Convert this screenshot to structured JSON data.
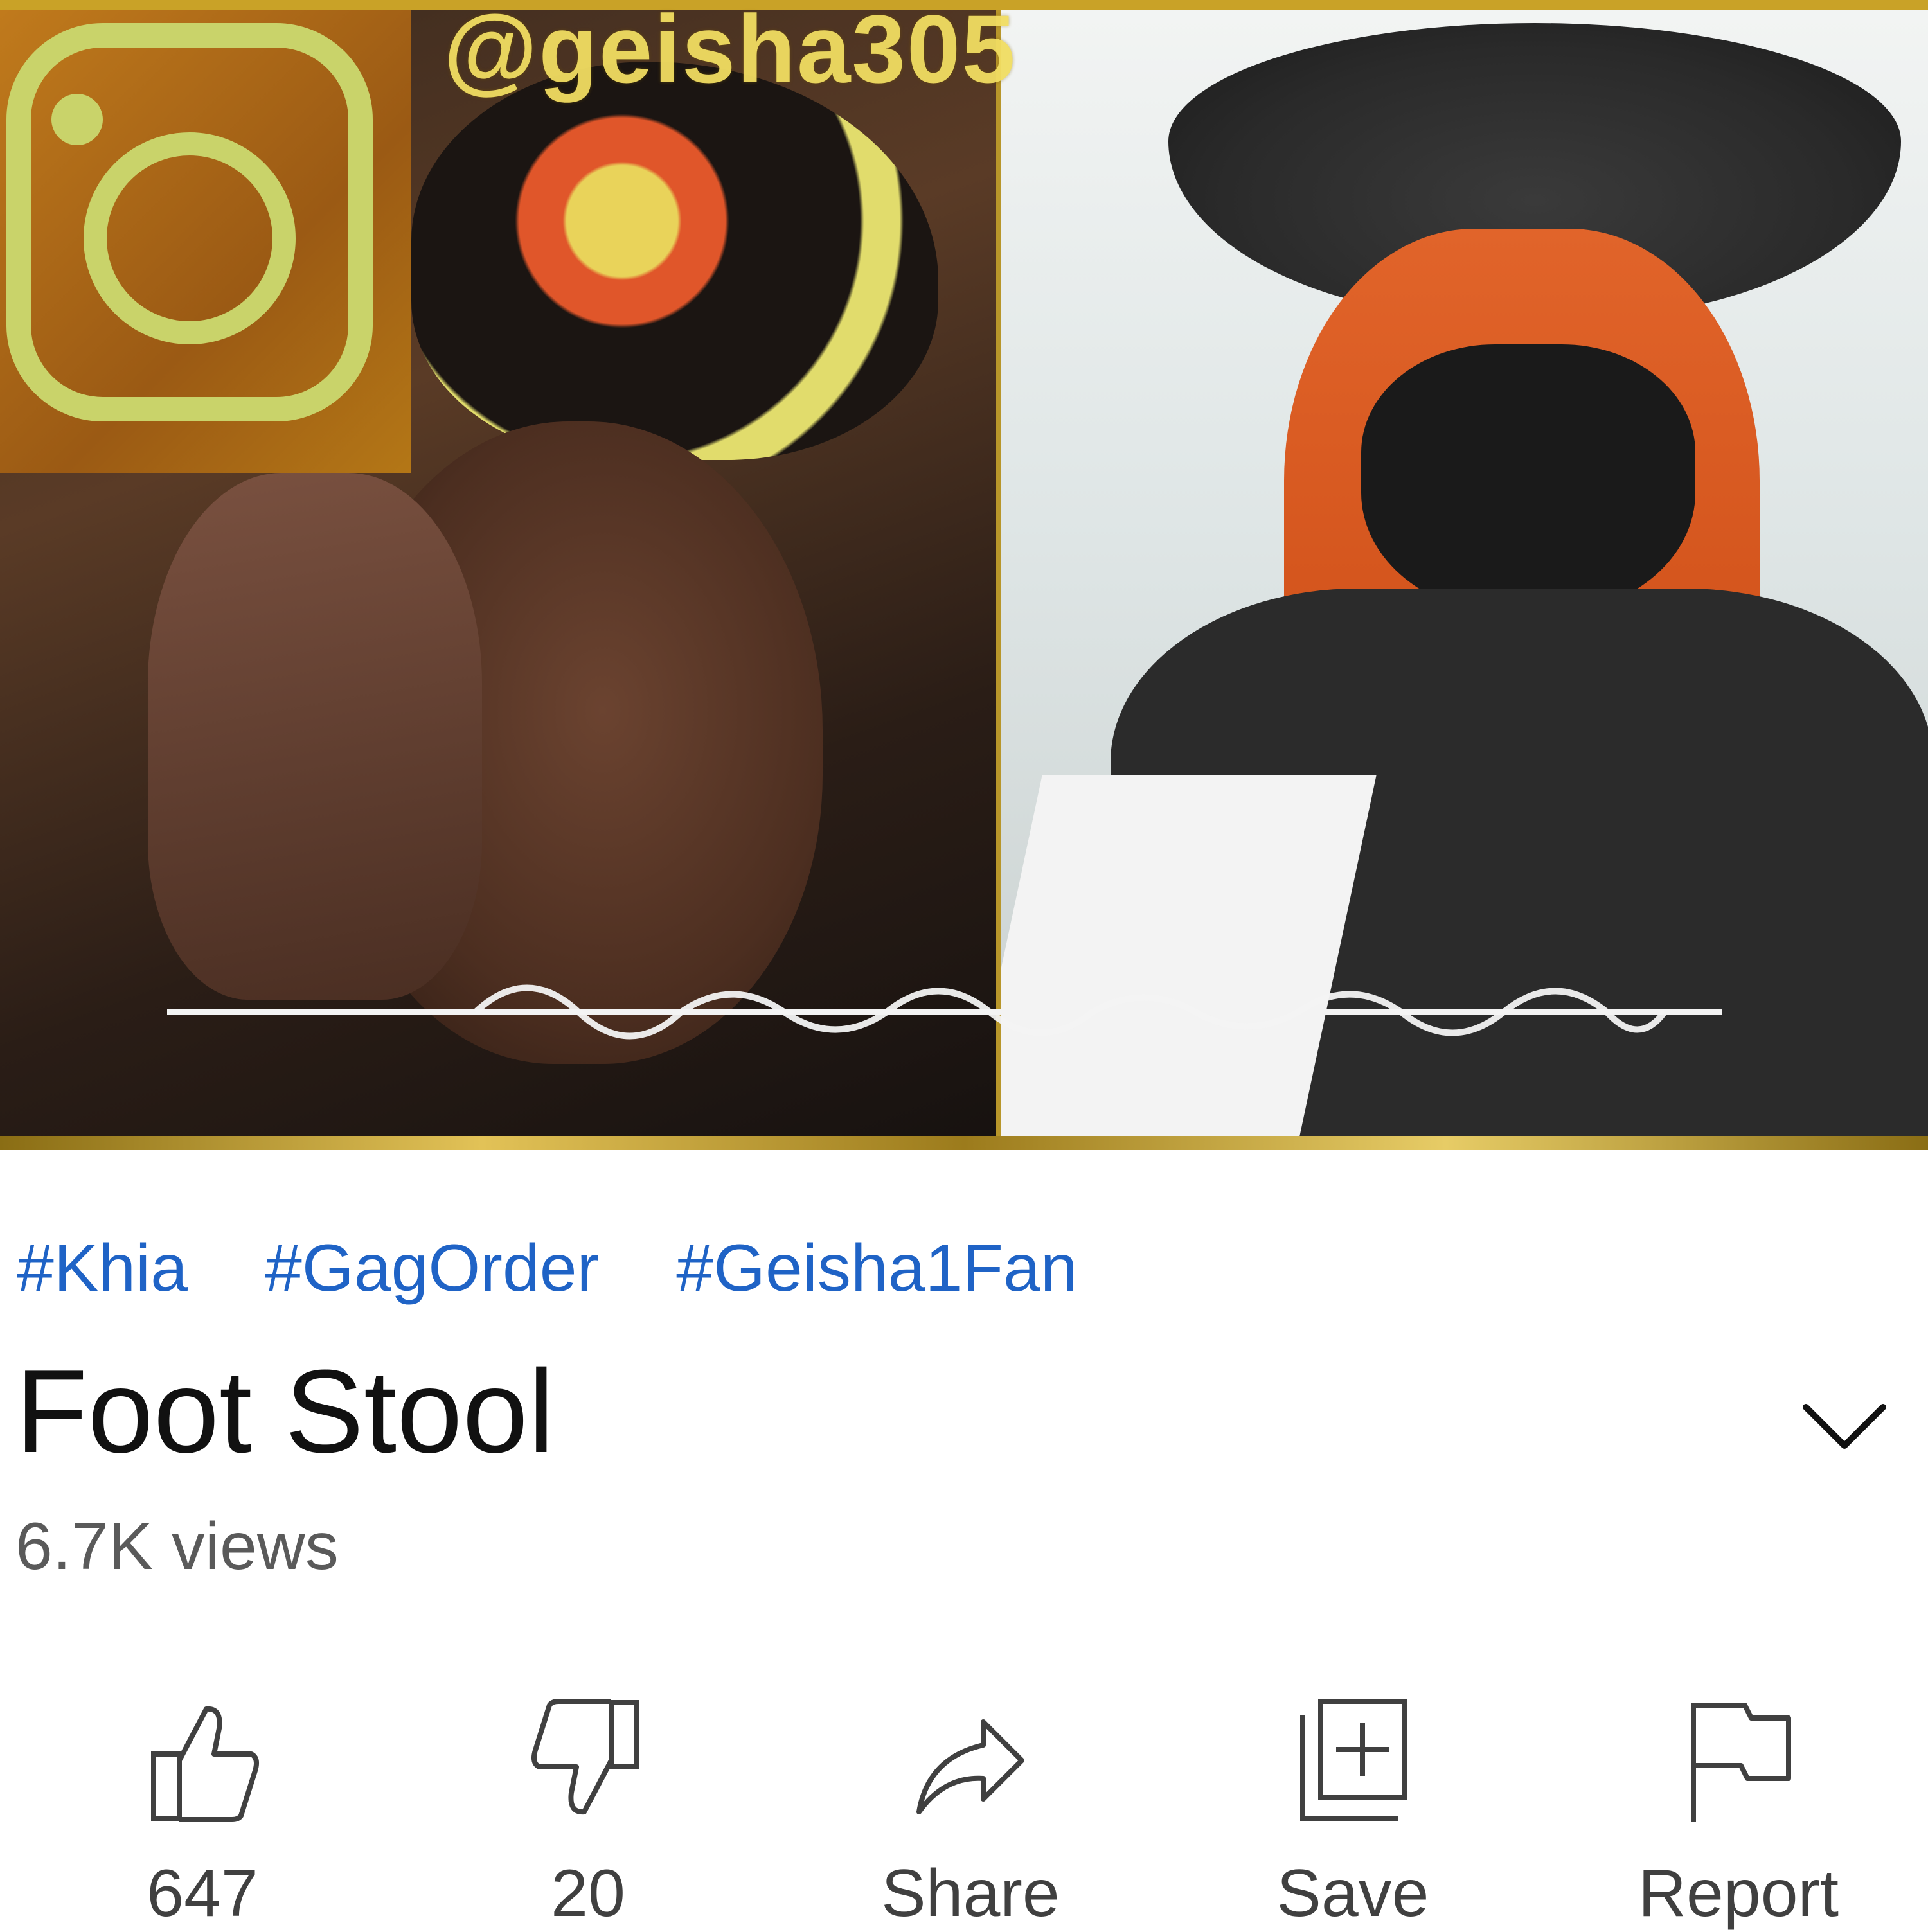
{
  "video": {
    "watermark_handle": "@geisha305",
    "instagram_logo_icon": "instagram-icon",
    "overlay_waveform": "audio-waveform-icon"
  },
  "hashtags": [
    "#Khia",
    "#GagOrder",
    "#Geisha1Fan"
  ],
  "title": "Foot Stool",
  "views": "6.7K views",
  "actions": {
    "like": {
      "label": "647",
      "icon": "thumbs-up-icon"
    },
    "dislike": {
      "label": "20",
      "icon": "thumbs-down-icon"
    },
    "share": {
      "label": "Share",
      "icon": "share-icon"
    },
    "save": {
      "label": "Save",
      "icon": "add-to-playlist-icon"
    },
    "report": {
      "label": "Report",
      "icon": "flag-icon"
    }
  },
  "colors": {
    "hashtag": "#1f63c6",
    "title": "#111111",
    "meta_text": "#5a5a5a",
    "icon": "#404040",
    "gold_border": "#c9a227"
  }
}
